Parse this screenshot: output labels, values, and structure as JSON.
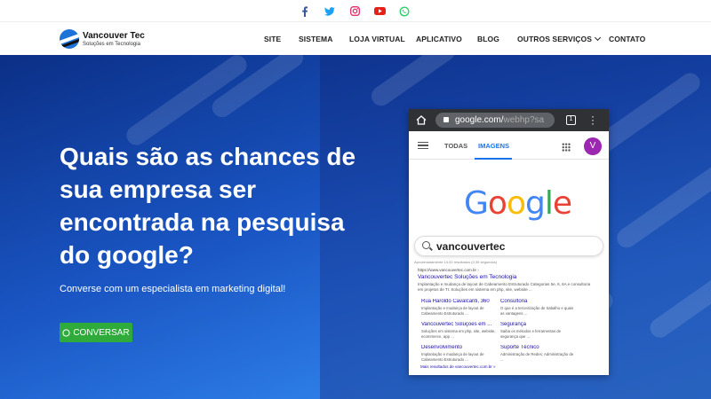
{
  "social": [
    "facebook-icon",
    "twitter-icon",
    "instagram-icon",
    "youtube-icon",
    "whatsapp-icon"
  ],
  "brand": {
    "title": "Vancouver Tec",
    "subtitle": "Soluções em Tecnologia"
  },
  "nav": {
    "site": "SITE",
    "sistema": "SISTEMA",
    "loja": "LOJA VIRTUAL",
    "aplicativo": "APLICATIVO",
    "blog": "BLOG",
    "outros": "OUTROS SERVIÇOS",
    "contato": "CONTATO"
  },
  "hero": {
    "title": "Quais são as chances de sua empresa ser encontrada na pesquisa do google?",
    "subtitle": "Converse com um especialista em marketing digital!",
    "cta": "CONVERSAR"
  },
  "phone": {
    "url": "google.com/",
    "url_rest": "webhp?sa",
    "tabs_count": "1",
    "tab_all": "TODAS",
    "tab_images": "IMAGENS",
    "avatar": "V",
    "google_logo": "Google",
    "query": "vancouvertec",
    "meta": "Aproximadamente 14,00 resultados (0,35 segundos)",
    "result_url": "https://www.vancouvertec.com.br ›",
    "result_title": "Vancouvertec Soluções em Tecnologia",
    "result_desc": "Implantação e mudança de layout de Cabeamento Estruturado Categorias 5e, 6, 6A e consultoria em projetos de TI. Soluções em sistema em php, site, website ...",
    "sitelinks": [
      {
        "title": "Rua Haroldo Cavalcanti, 360",
        "desc": "Implantação e mudança de layout de Cabeamento Estruturado ..."
      },
      {
        "title": "Consultoria",
        "desc": "O que é a terceirização de trabalho e quais as vantagens ..."
      },
      {
        "title": "Vancouvertec Soluções em ...",
        "desc": "Soluções em sistema em php, site, website, ecommerce, app ..."
      },
      {
        "title": "Segurança",
        "desc": "Saiba os métodos e ferramentas de segurança que ..."
      },
      {
        "title": "Desenvolvimento",
        "desc": "Implantação e mudança de layout de Cabeamento Estruturado ..."
      },
      {
        "title": "Suporte Técnico",
        "desc": "Administração de Redes; Administração de ..."
      }
    ],
    "more": "Mais resultados de vancouvertec.com.br »"
  },
  "colors": {
    "hero_start": "#0b2f86",
    "hero_end": "#3a8ff0",
    "cta": "#2eab3a",
    "google_blue": "#1a73e8"
  }
}
